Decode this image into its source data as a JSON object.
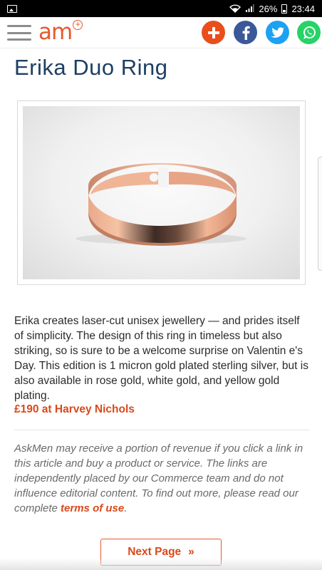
{
  "status_bar": {
    "battery": "26%",
    "time": "23:44"
  },
  "header": {
    "logo_text": "am",
    "logo_plus": "+",
    "icons": [
      "menu-icon",
      "add-share-icon",
      "facebook-icon",
      "twitter-icon",
      "whatsapp-icon"
    ]
  },
  "article": {
    "title": "Erika Duo Ring",
    "description": "Erika creates laser-cut unisex jewellery — and prides itself of simplicity. The design of this ring in timeless but also striking, so is sure to be a welcome surprise on Valentin e's Day. This edition is 1 micron gold plated sterling silver, but is also available in rose gold, white gold, and yellow gold plating.",
    "price_link": "£190 at Harvey Nichols"
  },
  "disclaimer": {
    "text": "AskMen may receive a portion of revenue if you click a link in this article and buy a product or service. The links are independently placed by our Commerce team and do not influence editorial content. To find out more, please read our complete ",
    "terms_link": "terms of use",
    "end": "."
  },
  "pagination": {
    "next_label": "Next Page",
    "next_arrow": "»"
  },
  "colors": {
    "accent": "#e8582d",
    "title": "#1e3f62",
    "facebook": "#3b5998",
    "twitter": "#1da1f2",
    "whatsapp": "#25d366"
  }
}
